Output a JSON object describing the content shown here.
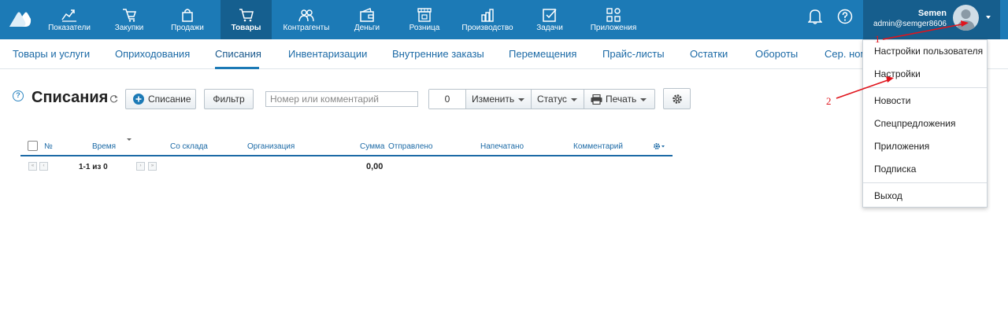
{
  "topbar": {
    "nav": [
      {
        "label": "Показатели",
        "icon": "chart-line-icon"
      },
      {
        "label": "Закупки",
        "icon": "basket-icon"
      },
      {
        "label": "Продажи",
        "icon": "shopping-bag-icon"
      },
      {
        "label": "Товары",
        "icon": "cart-icon"
      },
      {
        "label": "Контрагенты",
        "icon": "people-icon"
      },
      {
        "label": "Деньги",
        "icon": "wallet-icon"
      },
      {
        "label": "Розница",
        "icon": "store-icon"
      },
      {
        "label": "Производство",
        "icon": "factory-icon"
      },
      {
        "label": "Задачи",
        "icon": "checkbox-icon"
      },
      {
        "label": "Приложения",
        "icon": "apps-grid-icon"
      }
    ],
    "active_nav": "Товары",
    "user": {
      "name": "Semen",
      "login": "admin@semger8606"
    }
  },
  "subnav": {
    "items": [
      "Товары и услуги",
      "Оприходования",
      "Списания",
      "Инвентаризации",
      "Внутренние заказы",
      "Перемещения",
      "Прайс-листы",
      "Остатки",
      "Обороты",
      "Сер. ном"
    ],
    "active": "Списания"
  },
  "toolbar": {
    "title": "Списания",
    "add_button": "Списание",
    "filter_button": "Фильтр",
    "search_placeholder": "Номер или комментарий",
    "selected_count": "0",
    "change_button": "Изменить",
    "status_button": "Статус",
    "print_button": "Печать"
  },
  "table": {
    "columns": [
      "№",
      "Время",
      "Со склада",
      "Организация",
      "Сумма",
      "Отправлено",
      "Напечатано",
      "Комментарий"
    ],
    "pagination": "1-1 из 0",
    "total_sum": "0,00"
  },
  "dropdown": {
    "groups": [
      [
        "Настройки пользователя",
        "Настройки"
      ],
      [
        "Новости",
        "Спецпредложения",
        "Приложения",
        "Подписка"
      ],
      [
        "Выход"
      ]
    ]
  },
  "annotations": {
    "marks": [
      "1",
      "2"
    ],
    "color": "#e0141c"
  },
  "colors": {
    "topbar": "#1c7ab6",
    "active_nav": "#155f8f",
    "link": "#1c6aa6"
  }
}
